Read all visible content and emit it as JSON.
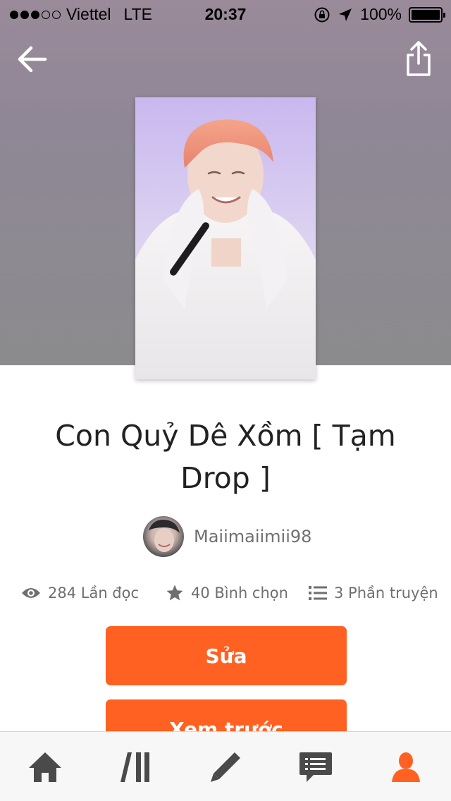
{
  "status_bar": {
    "carrier": "Viettel",
    "network": "LTE",
    "time": "20:37",
    "battery": "100%",
    "signal_bars_filled": 3,
    "signal_bars_total": 5,
    "battery_level_fraction": 1.0
  },
  "header": {
    "back_icon": "arrow-left-icon",
    "share_icon": "share-icon"
  },
  "story": {
    "title": "Con Quỷ Dê Xồm [ Tạm Drop ]",
    "author": "Maiimaiimii98",
    "stats": {
      "reads": "284 Lần đọc",
      "votes": "40 Bình chọn",
      "parts": "3 Phần truyện"
    }
  },
  "actions": {
    "edit_label": "Sửa",
    "preview_label": "Xem trước"
  },
  "tab_bar": {
    "items": [
      {
        "name": "home",
        "icon": "home-icon",
        "active": false
      },
      {
        "name": "library",
        "icon": "library-icon",
        "active": false
      },
      {
        "name": "write",
        "icon": "pencil-icon",
        "active": false
      },
      {
        "name": "messages",
        "icon": "message-icon",
        "active": false
      },
      {
        "name": "profile",
        "icon": "profile-icon",
        "active": true
      }
    ]
  },
  "colors": {
    "accent": "#ff6122",
    "icon_inactive": "#4a4a4a",
    "text_muted": "#6f6f6f"
  }
}
